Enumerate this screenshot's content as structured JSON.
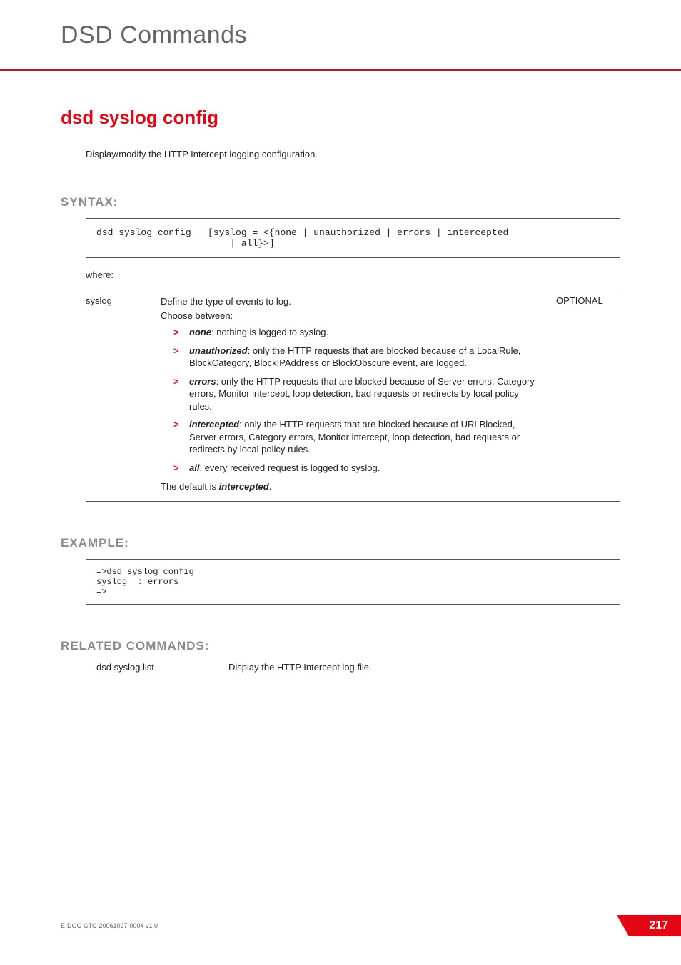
{
  "chapter_title": "DSD Commands",
  "command_title": "dsd syslog config",
  "intro": "Display/modify the HTTP Intercept logging configuration.",
  "syntax": {
    "heading": "SYNTAX:",
    "code": "dsd syslog config   [syslog = <{none | unauthorized | errors | intercepted\n                        | all}>]",
    "where_label": "where:"
  },
  "param": {
    "name": "syslog",
    "leadin1": "Define the type of events to log.",
    "leadin2": "Choose between:",
    "options": [
      {
        "term": "none",
        "rest": ": nothing is logged to syslog."
      },
      {
        "term": "unauthorized",
        "rest": ": only the HTTP requests that are blocked because of a LocalRule, BlockCategory, BlockIPAddress or BlockObscure event, are logged."
      },
      {
        "term": "errors",
        "rest": ": only the HTTP requests that are blocked because of Server errors, Category errors, Monitor intercept, loop detection, bad requests or redirects by local policy rules."
      },
      {
        "term": "intercepted",
        "rest": ": only the HTTP requests that are blocked because of URLBlocked, Server errors, Category errors, Monitor intercept, loop detection, bad requests or redirects by local policy rules."
      },
      {
        "term": "all",
        "rest": ": every received request is logged to syslog."
      }
    ],
    "default_prefix": "The default is ",
    "default_value": "intercepted",
    "default_suffix": ".",
    "optional": "OPTIONAL"
  },
  "example": {
    "heading": "EXAMPLE:",
    "code": "=>dsd syslog config\nsyslog  : errors\n=>"
  },
  "related": {
    "heading": "RELATED COMMANDS:",
    "cmd": "dsd syslog list",
    "desc": "Display the HTTP Intercept log file."
  },
  "footer": {
    "docid": "E-DOC-CTC-20061027-0004 v1.0",
    "page": "217"
  }
}
